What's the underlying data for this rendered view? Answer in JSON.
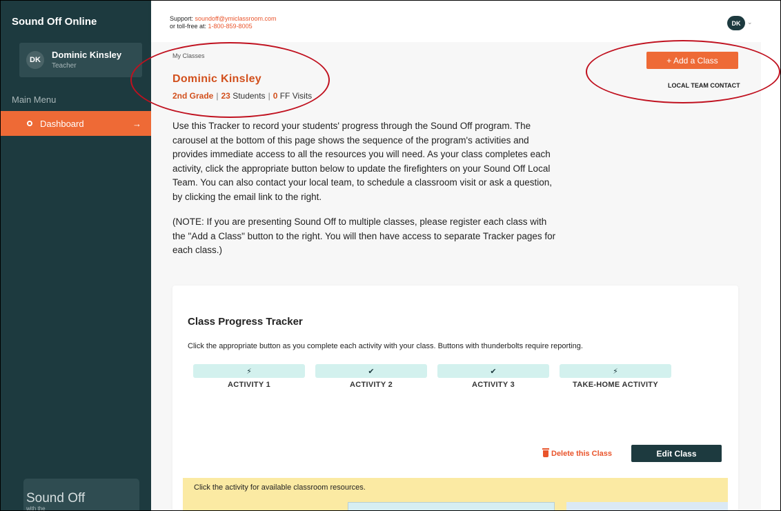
{
  "app": {
    "brand": "Sound Off Online"
  },
  "user": {
    "initials": "DK",
    "name": "Dominic Kinsley",
    "role": "Teacher"
  },
  "sidebar": {
    "menu_label": "Main Menu",
    "items": [
      {
        "label": "Dashboard",
        "arrow": "→",
        "active": true
      }
    ],
    "footer_logo": "Sound Off",
    "footer_sub": "with the"
  },
  "header": {
    "support_prefix": "Support: ",
    "support_email": "soundoff@ymiclassroom.com",
    "tollfree_prefix": "or toll-free at: ",
    "tollfree_number": "1-800-859-8005",
    "avatar_initials": "DK",
    "chevron": "⌄"
  },
  "page": {
    "breadcrumb": "My Classes",
    "teacher_name": "Dominic Kinsley",
    "grade": "2nd Grade",
    "sep": "|",
    "students_count": "23",
    "students_label": "Students",
    "ff_visits_count": "0",
    "ff_visits_label": "FF Visits",
    "intro": "Use this Tracker to record your students' progress through the Sound Off program. The carousel at the bottom of this page shows the sequence of the program's activities and provides immediate access to all the resources you will need. As your class completes each activity, click the appropriate button below to update the firefighters on your Sound Off Local Team. You can also contact your local team, to schedule a classroom visit or ask a question, by clicking the email link to the right.",
    "note": "(NOTE: If you are presenting Sound Off to multiple classes, please register each class with the \"Add a Class\" button to the right. You will then have access to separate Tracker pages for each class.)",
    "add_class_label": "+ Add a Class",
    "local_team_label": "LOCAL TEAM CONTACT"
  },
  "tracker": {
    "title": "Class Progress Tracker",
    "description": "Click the appropriate button as you complete each activity with your class. Buttons with thunderbolts require reporting.",
    "activities": [
      {
        "label": "ACTIVITY 1",
        "icon": "⚡",
        "icon_name": "thunderbolt-icon"
      },
      {
        "label": "ACTIVITY 2",
        "icon": "✔",
        "icon_name": "check-icon"
      },
      {
        "label": "ACTIVITY 3",
        "icon": "✔",
        "icon_name": "check-icon"
      },
      {
        "label": "TAKE-HOME ACTIVITY",
        "icon": "⚡",
        "icon_name": "thunderbolt-icon"
      }
    ],
    "delete_label": "Delete this Class",
    "edit_label": "Edit Class"
  },
  "resources": {
    "text": "Click the activity for available classroom resources."
  },
  "colors": {
    "sidebar_bg": "#1d3a3f",
    "accent_orange": "#ee6a36",
    "activity_pill": "#d3f1ee",
    "resources_bg": "#fbeaa3",
    "annotation_red": "#c0111f"
  }
}
